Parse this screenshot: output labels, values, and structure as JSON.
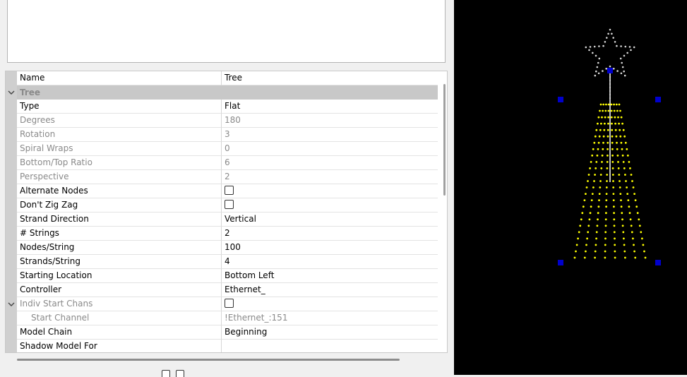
{
  "properties": {
    "header": {
      "name": "Name",
      "value": "Tree"
    },
    "category": "Tree",
    "rows": [
      {
        "label": "Type",
        "value": "Flat",
        "disabled": false,
        "kind": "text"
      },
      {
        "label": "Degrees",
        "value": "180",
        "disabled": true,
        "kind": "text"
      },
      {
        "label": "Rotation",
        "value": "3",
        "disabled": true,
        "kind": "text"
      },
      {
        "label": "Spiral Wraps",
        "value": "0",
        "disabled": true,
        "kind": "text"
      },
      {
        "label": "Bottom/Top Ratio",
        "value": "6",
        "disabled": true,
        "kind": "text"
      },
      {
        "label": "Perspective",
        "value": "2",
        "disabled": true,
        "kind": "text"
      },
      {
        "label": "Alternate Nodes",
        "value": "",
        "disabled": false,
        "kind": "checkbox",
        "checked": false
      },
      {
        "label": "Don't Zig Zag",
        "value": "",
        "disabled": false,
        "kind": "checkbox",
        "checked": false
      },
      {
        "label": "Strand Direction",
        "value": "Vertical",
        "disabled": false,
        "kind": "text"
      },
      {
        "label": "# Strings",
        "value": "2",
        "disabled": false,
        "kind": "text"
      },
      {
        "label": "Nodes/String",
        "value": "100",
        "disabled": false,
        "kind": "text"
      },
      {
        "label": "Strands/String",
        "value": "4",
        "disabled": false,
        "kind": "text"
      },
      {
        "label": "Starting Location",
        "value": "Bottom Left",
        "disabled": false,
        "kind": "text"
      },
      {
        "label": "Controller",
        "value": "Ethernet_",
        "disabled": false,
        "kind": "text"
      },
      {
        "label": "Indiv Start Chans",
        "value": "",
        "disabled": true,
        "kind": "checkbox",
        "checked": false,
        "expandable": true
      },
      {
        "label": "Start Channel",
        "value": "!Ethernet_:151",
        "disabled": true,
        "kind": "text",
        "indent": true
      },
      {
        "label": "Model Chain",
        "value": "Beginning",
        "disabled": false,
        "kind": "text"
      },
      {
        "label": "Shadow Model For",
        "value": "",
        "disabled": false,
        "kind": "text"
      }
    ]
  },
  "icons": {
    "expand": "chevron-down-icon"
  },
  "preview": {
    "background": "#000000",
    "tree_color": "#ffff00",
    "star_color": "#d8d8d8",
    "handle_color": "#0000cc",
    "trunk_color": "#ffffff"
  }
}
